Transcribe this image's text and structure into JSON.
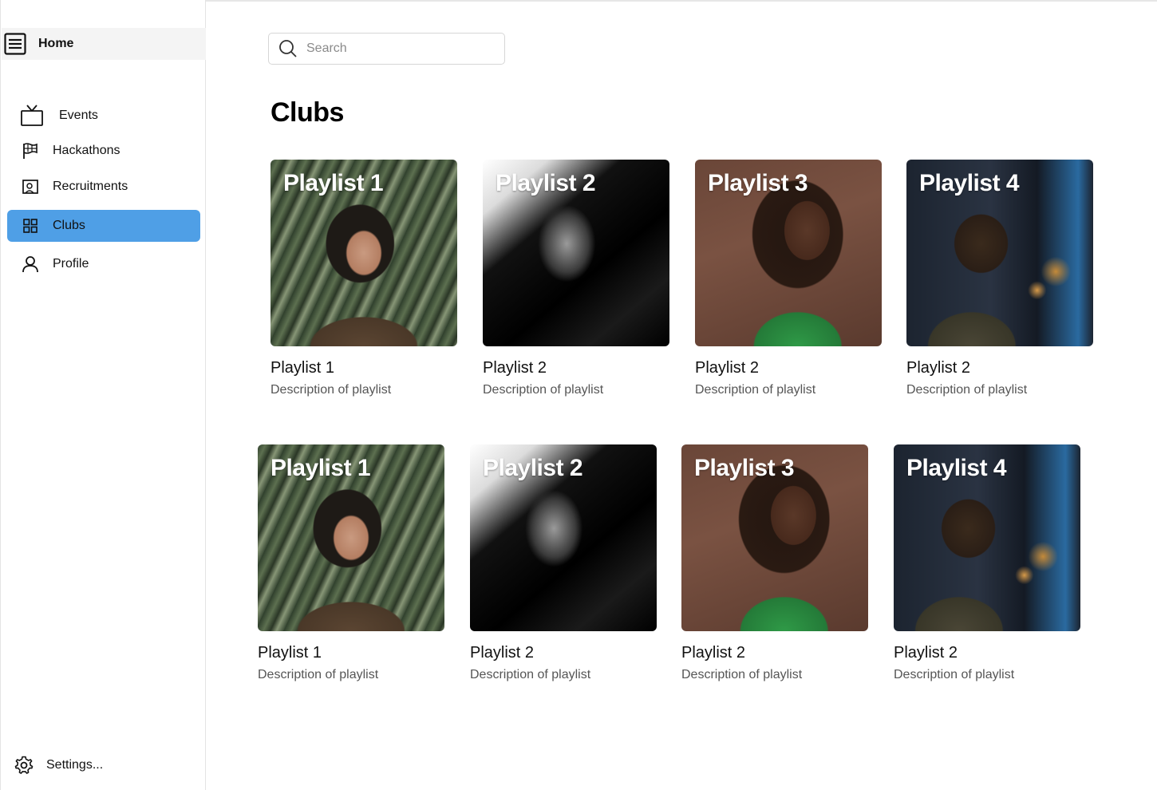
{
  "sidebar": {
    "home_label": "Home",
    "items": [
      {
        "label": "Events",
        "icon": "tv-icon",
        "active": false
      },
      {
        "label": "Hackathons",
        "icon": "flag-icon",
        "active": false
      },
      {
        "label": "Recruitments",
        "icon": "portrait-icon",
        "active": false
      },
      {
        "label": "Clubs",
        "icon": "grid-icon",
        "active": true
      },
      {
        "label": "Profile",
        "icon": "user-icon",
        "active": false
      }
    ],
    "settings_label": "Settings..."
  },
  "search": {
    "placeholder": "Search",
    "value": ""
  },
  "main": {
    "title": "Clubs"
  },
  "cards": [
    {
      "cover_title": "Playlist 1",
      "title": "Playlist 1",
      "description": "Description of playlist"
    },
    {
      "cover_title": "Playlist 2",
      "title": "Playlist 2",
      "description": "Description of playlist"
    },
    {
      "cover_title": "Playlist 3",
      "title": "Playlist 2",
      "description": "Description of playlist"
    },
    {
      "cover_title": "Playlist 4",
      "title": "Playlist 2",
      "description": "Description of playlist"
    },
    {
      "cover_title": "Playlist 1",
      "title": "Playlist 1",
      "description": "Description of playlist"
    },
    {
      "cover_title": "Playlist 2",
      "title": "Playlist 2",
      "description": "Description of playlist"
    },
    {
      "cover_title": "Playlist 3",
      "title": "Playlist 2",
      "description": "Description of playlist"
    },
    {
      "cover_title": "Playlist 4",
      "title": "Playlist 2",
      "description": "Description of playlist"
    }
  ],
  "colors": {
    "active_nav": "#4f9fe6",
    "home_bg": "#f4f4f4"
  }
}
